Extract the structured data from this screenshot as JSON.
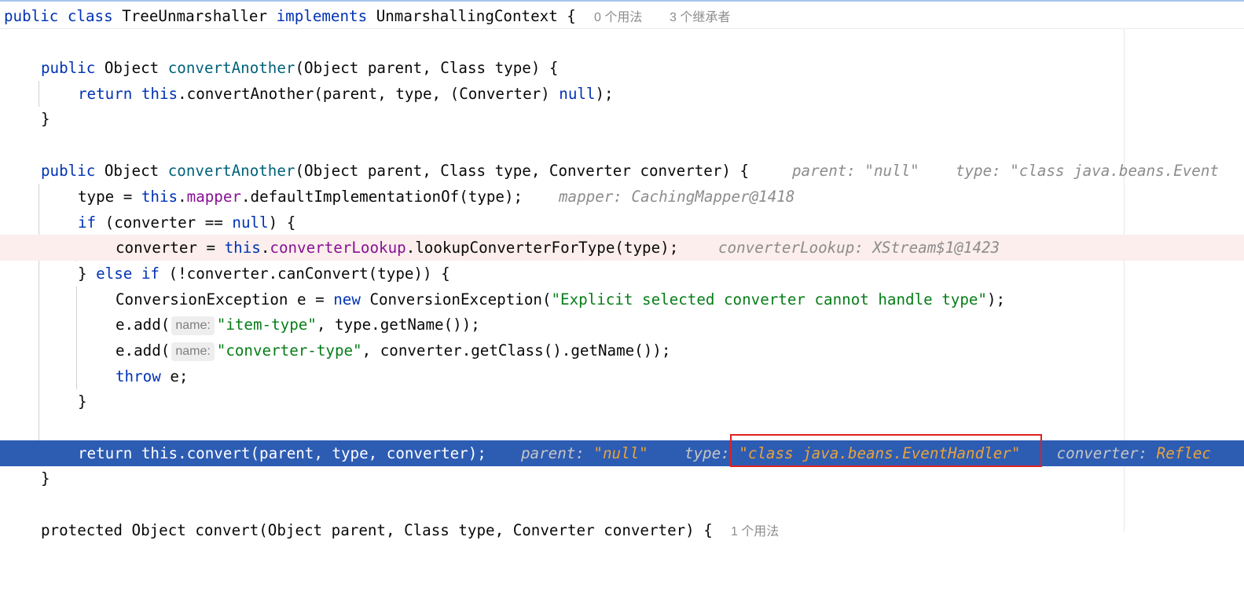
{
  "sticky_header": {
    "pub": "public",
    "cls": "class",
    "name": "TreeUnmarshaller",
    "impl": "implements",
    "iface": "UnmarshallingContext",
    "brace": " {",
    "usages": "0 个用法",
    "inheritors": "3 个继承者"
  },
  "l1": {
    "pub": "public",
    "sig_a": " Object ",
    "fn": "convertAnother",
    "sig_b": "(Object parent, Class type) {"
  },
  "l2": {
    "ret": "return",
    "this": "this",
    "rest_a": ".convertAnother(parent, type, (Converter) ",
    "nul": "null",
    "rest_b": ");"
  },
  "l3": {
    "brace": "}"
  },
  "l4": {
    "pub": "public",
    "sig_a": " Object ",
    "fn": "convertAnother",
    "sig_b": "(Object parent, Class type, Converter converter) {",
    "inl_parent_k": "parent: ",
    "inl_parent_v": "\"null\"",
    "inl_type_k": "type: ",
    "inl_type_v": "\"class java.beans.Event"
  },
  "l5": {
    "a": "type = ",
    "this": "this",
    "dot": ".",
    "fld": "mapper",
    "b": ".defaultImplementationOf(type);",
    "inl": "mapper: CachingMapper@1418"
  },
  "l6": {
    "if": "if",
    "a": " (converter == ",
    "nul": "null",
    "b": ") {"
  },
  "l7": {
    "a": "converter = ",
    "this": "this",
    "dot": ".",
    "fld": "converterLookup",
    "b": ".lookupConverterForType(type);",
    "inl": "converterLookup: XStream$1@1423"
  },
  "l8": {
    "a": "} ",
    "else": "else if",
    "b": " (!converter.canConvert(type)) {"
  },
  "l9": {
    "a": "ConversionException e = ",
    "new": "new",
    "b": " ConversionException(",
    "str": "\"Explicit selected converter cannot handle type\"",
    "c": ");"
  },
  "l10": {
    "a": "e.add(",
    "hint": "name:",
    "str": "\"item-type\"",
    "b": ", type.getName());"
  },
  "l11": {
    "a": "e.add(",
    "hint": "name:",
    "str": "\"converter-type\"",
    "b": ", converter.getClass().getName());"
  },
  "l12": {
    "kw": "throw",
    "a": " e;"
  },
  "l13": {
    "brace": "}"
  },
  "l14": {
    "code": "return this.convert(parent, type, converter);",
    "inl_parent_k": "parent: ",
    "inl_parent_v": "\"null\"",
    "inl_type_k": "type: ",
    "inl_type_v": "\"class java.beans.EventHandler\"",
    "inl_conv_k": "converter: ",
    "inl_conv_v": "Reflec"
  },
  "l15": {
    "brace": "}"
  },
  "l16": {
    "code": "protected Object convert(Object parent, Class type, Converter converter) {",
    "meta": "1 个用法"
  },
  "colors": {
    "selected_line": "#2d5cb3",
    "breakpoint_line": "#fbeeec",
    "keyword": "#0033b3",
    "string": "#067d17",
    "field": "#871094",
    "method": "#00627a",
    "annotation_box": "#e02020"
  }
}
